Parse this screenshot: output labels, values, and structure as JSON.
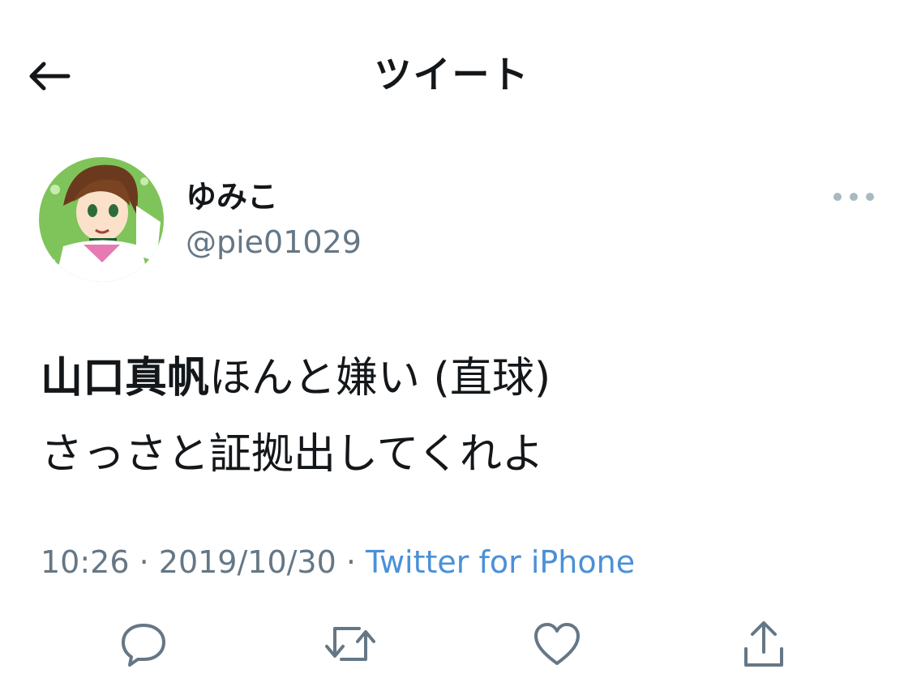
{
  "header": {
    "title": "ツイート",
    "back_icon": "arrow-left-icon"
  },
  "author": {
    "display_name": "ゆみこ",
    "handle": "@pie01029",
    "avatar_icon": "avatar-image",
    "more_icon": "more-horizontal-icon"
  },
  "tweet": {
    "line1_bold": "山口真帆",
    "line1_rest": "ほんと嫌い (直球)",
    "line2": "さっさと証拠出してくれよ"
  },
  "meta": {
    "time": "10:26",
    "separator1": " · ",
    "date": "2019/10/30",
    "separator2": " · ",
    "source": "Twitter for iPhone"
  },
  "actions": [
    {
      "name": "reply",
      "icon": "reply-icon"
    },
    {
      "name": "retweet",
      "icon": "retweet-icon"
    },
    {
      "name": "like",
      "icon": "heart-icon"
    },
    {
      "name": "share",
      "icon": "share-icon"
    }
  ],
  "colors": {
    "text": "#14171a",
    "secondary": "#657786",
    "link": "#4a90d9",
    "icon": "#657786"
  }
}
